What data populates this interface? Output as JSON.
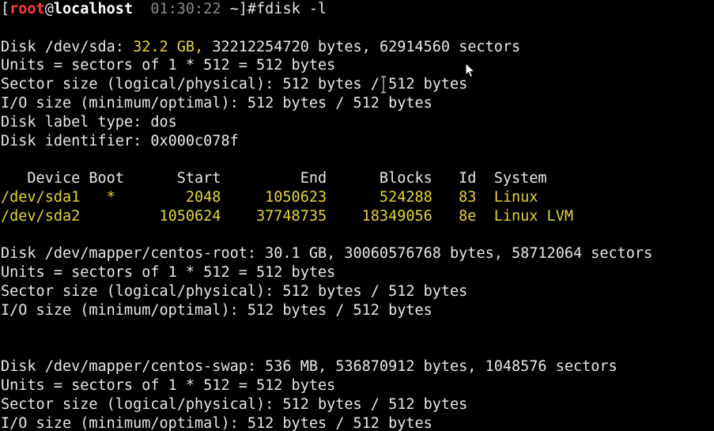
{
  "prompt": {
    "open_bracket": "[",
    "user": "root",
    "at": "@",
    "host": "localhost",
    "time": "  01:30:22 ",
    "path": "~]#",
    "command": "fdisk -l"
  },
  "sda": {
    "disk_prefix": "Disk /dev/sda: ",
    "disk_size": "32.2 GB,",
    "disk_rest": " 32212254720 bytes, 62914560 sectors",
    "units": "Units = sectors of 1 * 512 = 512 bytes",
    "sector_size": "Sector size (logical/physical): 512 bytes / 512 bytes",
    "io_size": "I/O size (minimum/optimal): 512 bytes / 512 bytes",
    "label_type": "Disk label type: dos",
    "identifier": "Disk identifier: 0x000c078f"
  },
  "partition_table": {
    "header": "   Device Boot      Start         End      Blocks   Id  System",
    "rows": [
      "/dev/sda1   *        2048     1050623      524288   83  Linux",
      "/dev/sda2         1050624    37748735    18349056   8e  Linux LVM"
    ]
  },
  "centos_root": {
    "disk": "Disk /dev/mapper/centos-root: 30.1 GB, 30060576768 bytes, 58712064 sectors",
    "units": "Units = sectors of 1 * 512 = 512 bytes",
    "sector_size": "Sector size (logical/physical): 512 bytes / 512 bytes",
    "io_size": "I/O size (minimum/optimal): 512 bytes / 512 bytes"
  },
  "centos_swap": {
    "disk": "Disk /dev/mapper/centos-swap: 536 MB, 536870912 bytes, 1048576 sectors",
    "units": "Units = sectors of 1 * 512 = 512 bytes",
    "sector_size": "Sector size (logical/physical): 512 bytes / 512 bytes",
    "io_size": "I/O size (minimum/optimal): 512 bytes / 512 bytes"
  },
  "colors": {
    "background": "#000000",
    "text": "#e8e8e8",
    "highlight": "#e6d33c",
    "prompt_user": "#ff3b3b",
    "prompt_time": "#8a8a8a"
  },
  "icons": {
    "mouse_pointer": "mouse-pointer-icon",
    "text_cursor": "text-cursor-icon"
  }
}
